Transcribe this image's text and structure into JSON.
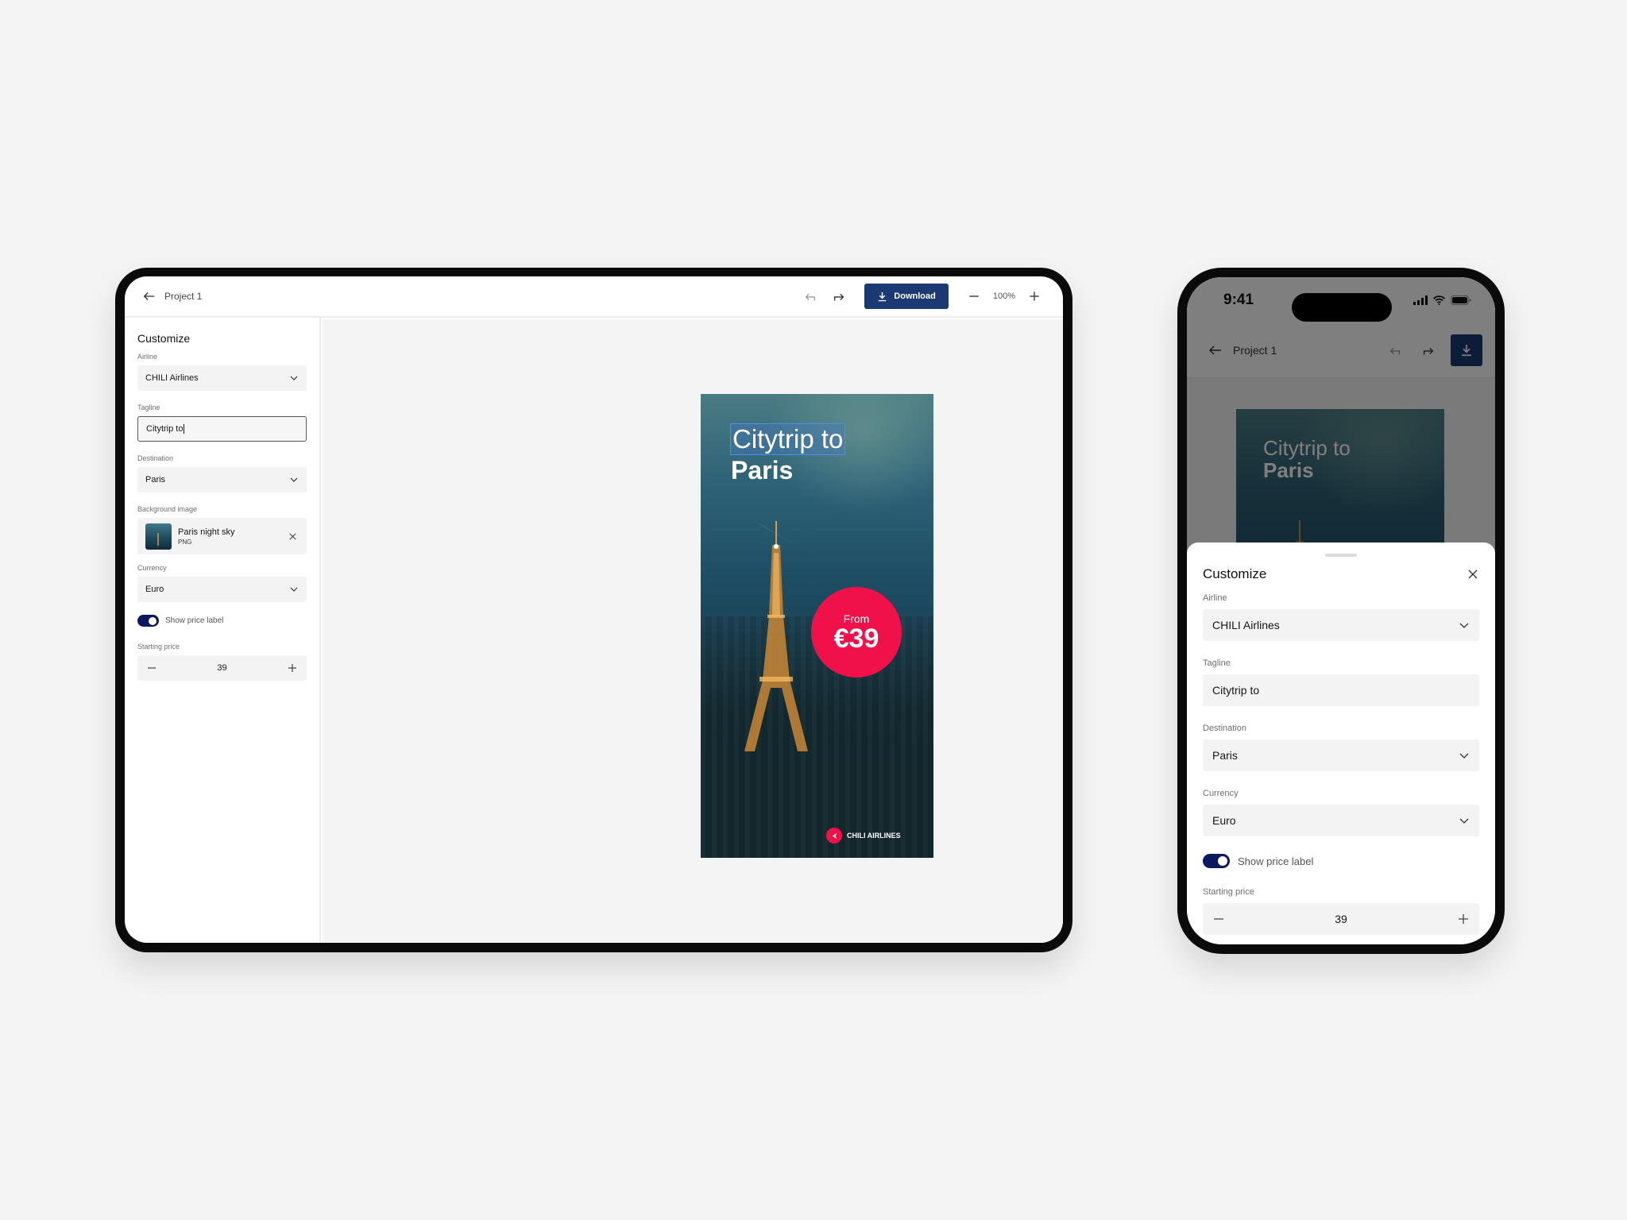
{
  "tablet": {
    "header": {
      "project_title": "Project 1",
      "download_label": "Download",
      "zoom_level": "100%"
    },
    "panel": {
      "title": "Customize",
      "airline": {
        "label": "Airline",
        "value": "CHILI Airlines"
      },
      "tagline": {
        "label": "Tagline",
        "value": "Citytrip to"
      },
      "destination": {
        "label": "Destination",
        "value": "Paris"
      },
      "background_image": {
        "label": "Background image",
        "file_name": "Paris night sky",
        "file_type": "PNG"
      },
      "currency": {
        "label": "Currency",
        "value": "Euro"
      },
      "show_price_label": {
        "label": "Show price label",
        "checked": true
      },
      "starting_price": {
        "label": "Starting price",
        "value": "39"
      }
    },
    "preview": {
      "tagline": "Citytrip to",
      "destination": "Paris",
      "price_prefix": "From",
      "price": "€39",
      "brand": "CHILI AIRLINES"
    }
  },
  "phone": {
    "status_bar": {
      "time": "9:41"
    },
    "header": {
      "project_title": "Project 1"
    },
    "preview": {
      "tagline": "Citytrip to",
      "destination": "Paris"
    },
    "sheet": {
      "title": "Customize",
      "airline": {
        "label": "Airline",
        "value": "CHILI Airlines"
      },
      "tagline": {
        "label": "Tagline",
        "value": "Citytrip to"
      },
      "destination": {
        "label": "Destination",
        "value": "Paris"
      },
      "currency": {
        "label": "Currency",
        "value": "Euro"
      },
      "show_price_label": {
        "label": "Show price label",
        "checked": true
      },
      "starting_price": {
        "label": "Starting price",
        "value": "39"
      }
    }
  },
  "colors": {
    "primary_button": "#1b3a73",
    "toggle_on": "#0b1a5e",
    "price_badge": "#f0104a"
  }
}
